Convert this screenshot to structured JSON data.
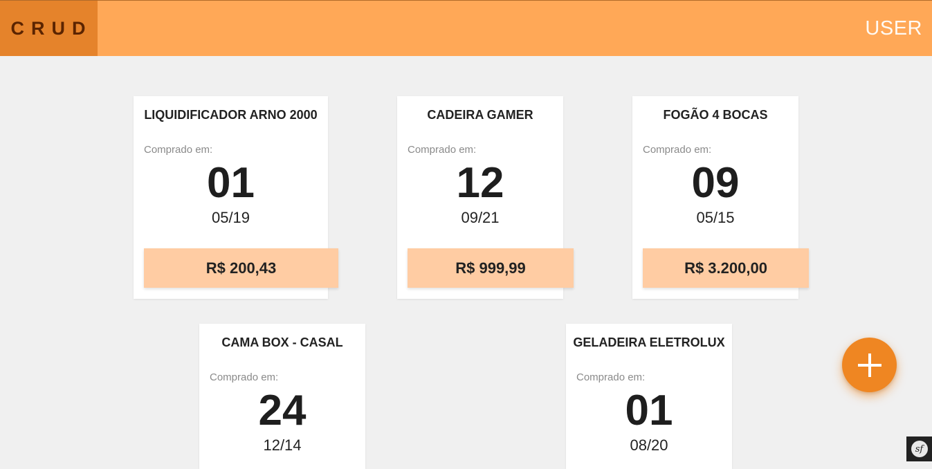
{
  "header": {
    "brand": "CRUD",
    "user": "USER"
  },
  "cards": [
    {
      "title": "LIQUIDIFICADOR ARNO 2000",
      "purchased_label": "Comprado em:",
      "day": "01",
      "month_year": "05/19",
      "price": "R$ 200,43"
    },
    {
      "title": "CADEIRA GAMER",
      "purchased_label": "Comprado em:",
      "day": "12",
      "month_year": "09/21",
      "price": "R$ 999,99"
    },
    {
      "title": "FOGÃO 4 BOCAS",
      "purchased_label": "Comprado em:",
      "day": "09",
      "month_year": "05/15",
      "price": "R$ 3.200,00"
    },
    {
      "title": "CAMA BOX - CASAL",
      "purchased_label": "Comprado em:",
      "day": "24",
      "month_year": "12/14"
    },
    {
      "title": "GELADEIRA ELETROLUX",
      "purchased_label": "Comprado em:",
      "day": "01",
      "month_year": "08/20"
    }
  ],
  "fab": {
    "icon": "plus-icon"
  },
  "corner_badge": {
    "icon": "symfony-icon",
    "text": "sf"
  },
  "colors": {
    "header": "#ffa857",
    "brand": "#e5832b",
    "price": "#ffcca3",
    "fab": "#ef8622"
  }
}
